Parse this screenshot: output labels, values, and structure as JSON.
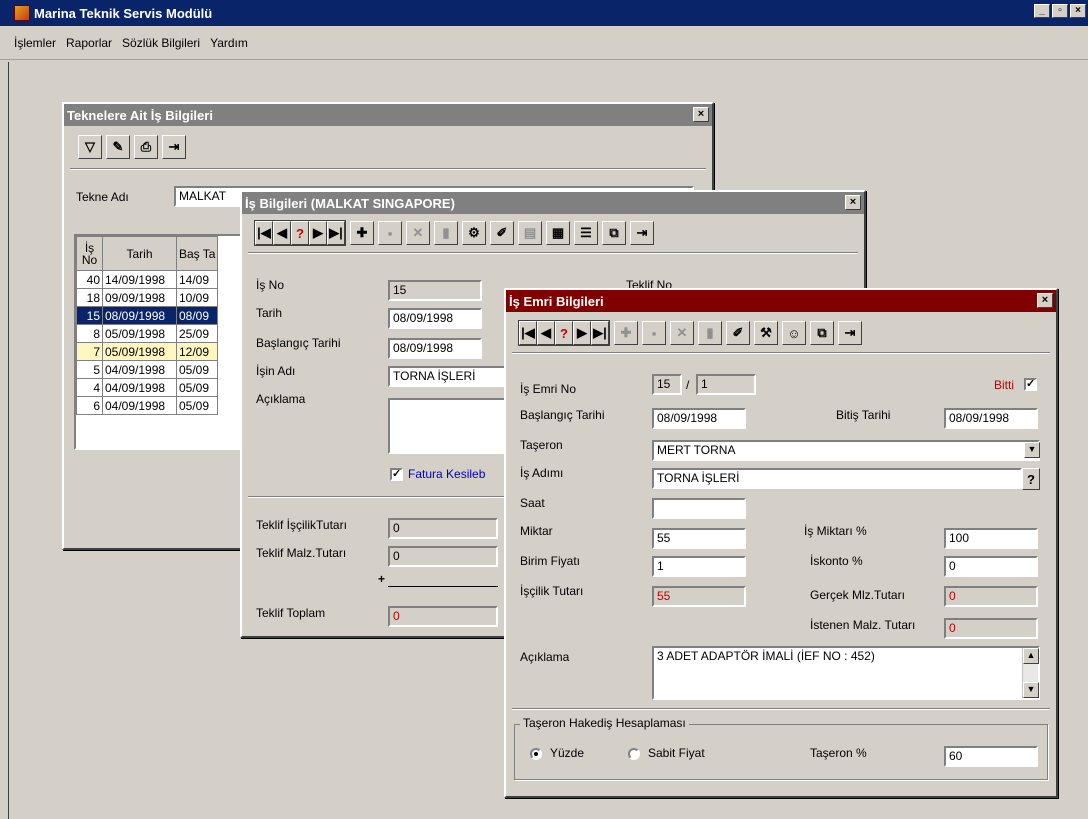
{
  "app": {
    "title": "Marina Teknik Servis Modülü",
    "btn_min": "_",
    "btn_max": "▫",
    "btn_close": "×"
  },
  "menu": [
    "İşlemler",
    "Raporlar",
    "Sözlük Bilgileri",
    "Yardım"
  ],
  "w1": {
    "title": "Teknelere Ait İş Bilgileri",
    "close": "×",
    "tekne_label": "Tekne Adı",
    "tekne_value": "MALKAT",
    "headers": [
      "İş No",
      "Tarih",
      "Baş Ta"
    ],
    "rows": [
      [
        "40",
        "14/09/1998",
        "14/09"
      ],
      [
        "18",
        "09/09/1998",
        "10/09"
      ],
      [
        "15",
        "08/09/1998",
        "08/09"
      ],
      [
        "8",
        "05/09/1998",
        "25/09"
      ],
      [
        "7",
        "05/09/1998",
        "12/09"
      ],
      [
        "5",
        "04/09/1998",
        "05/09"
      ],
      [
        "4",
        "04/09/1998",
        "05/09"
      ],
      [
        "6",
        "04/09/1998",
        "05/09"
      ]
    ]
  },
  "w2": {
    "title": "İş Bilgileri (MALKAT SINGAPORE)",
    "close": "×",
    "is_no_label": "İş No",
    "is_no": "15",
    "teklif_no_label": "Teklif No",
    "tarih_label": "Tarih",
    "tarih": "08/09/1998",
    "bas_label": "Başlangıç Tarihi",
    "bas": "08/09/1998",
    "isin_adi_label": "İşin Adı",
    "isin_adi": "TORNA İŞLERİ",
    "aciklama_label": "Açıklama",
    "fatura_label": "Fatura Kesileb",
    "teklif_iscilik_label": "Teklif İşçilikTutarı",
    "teklif_iscilik": "0",
    "teklif_malz_label": "Teklif Malz.Tutarı",
    "teklif_malz": "0",
    "plus": "+",
    "teklif_toplam_label": "Teklif Toplam",
    "teklif_toplam": "0"
  },
  "w3": {
    "title": "İş Emri Bilgileri",
    "close": "×",
    "is_emri_no_label": "İş Emri No",
    "is_emri_no": "15",
    "slash": "/",
    "is_emri_sub": "1",
    "bitti_label": "Bitti",
    "bitti_check": "✓",
    "bas_label": "Başlangıç Tarihi",
    "bas": "08/09/1998",
    "bitis_label": "Bitiş Tarihi",
    "bitis": "08/09/1998",
    "taseron_label": "Taşeron",
    "taseron": "MERT TORNA",
    "is_adimi_label": "İş Adımı",
    "is_adimi": "TORNA İŞLERİ",
    "q": "?",
    "saat_label": "Saat",
    "saat": "",
    "miktar_label": "Miktar",
    "miktar": "55",
    "is_miktari_label": "İş Miktarı %",
    "is_miktari": "100",
    "birim_label": "Birim Fiyatı",
    "birim": "1",
    "iskonto_label": "İskonto %",
    "iskonto": "0",
    "iscilik_label": "İşçilik Tutarı",
    "iscilik": "55",
    "gercek_label": "Gerçek Mlz.Tutarı",
    "gercek": "0",
    "istenen_label": "İstenen Malz. Tutarı",
    "istenen": "0",
    "aciklama_label": "Açıklama",
    "aciklama": "3 ADET ADAPTÖR İMALİ (İEF NO : 452)",
    "hakedis_label": "Taşeron Hakediş Hesaplaması",
    "yuzde_label": "Yüzde",
    "sabit_label": "Sabit Fiyat",
    "taseron_pct_label": "Taşeron %",
    "taseron_pct": "60"
  }
}
